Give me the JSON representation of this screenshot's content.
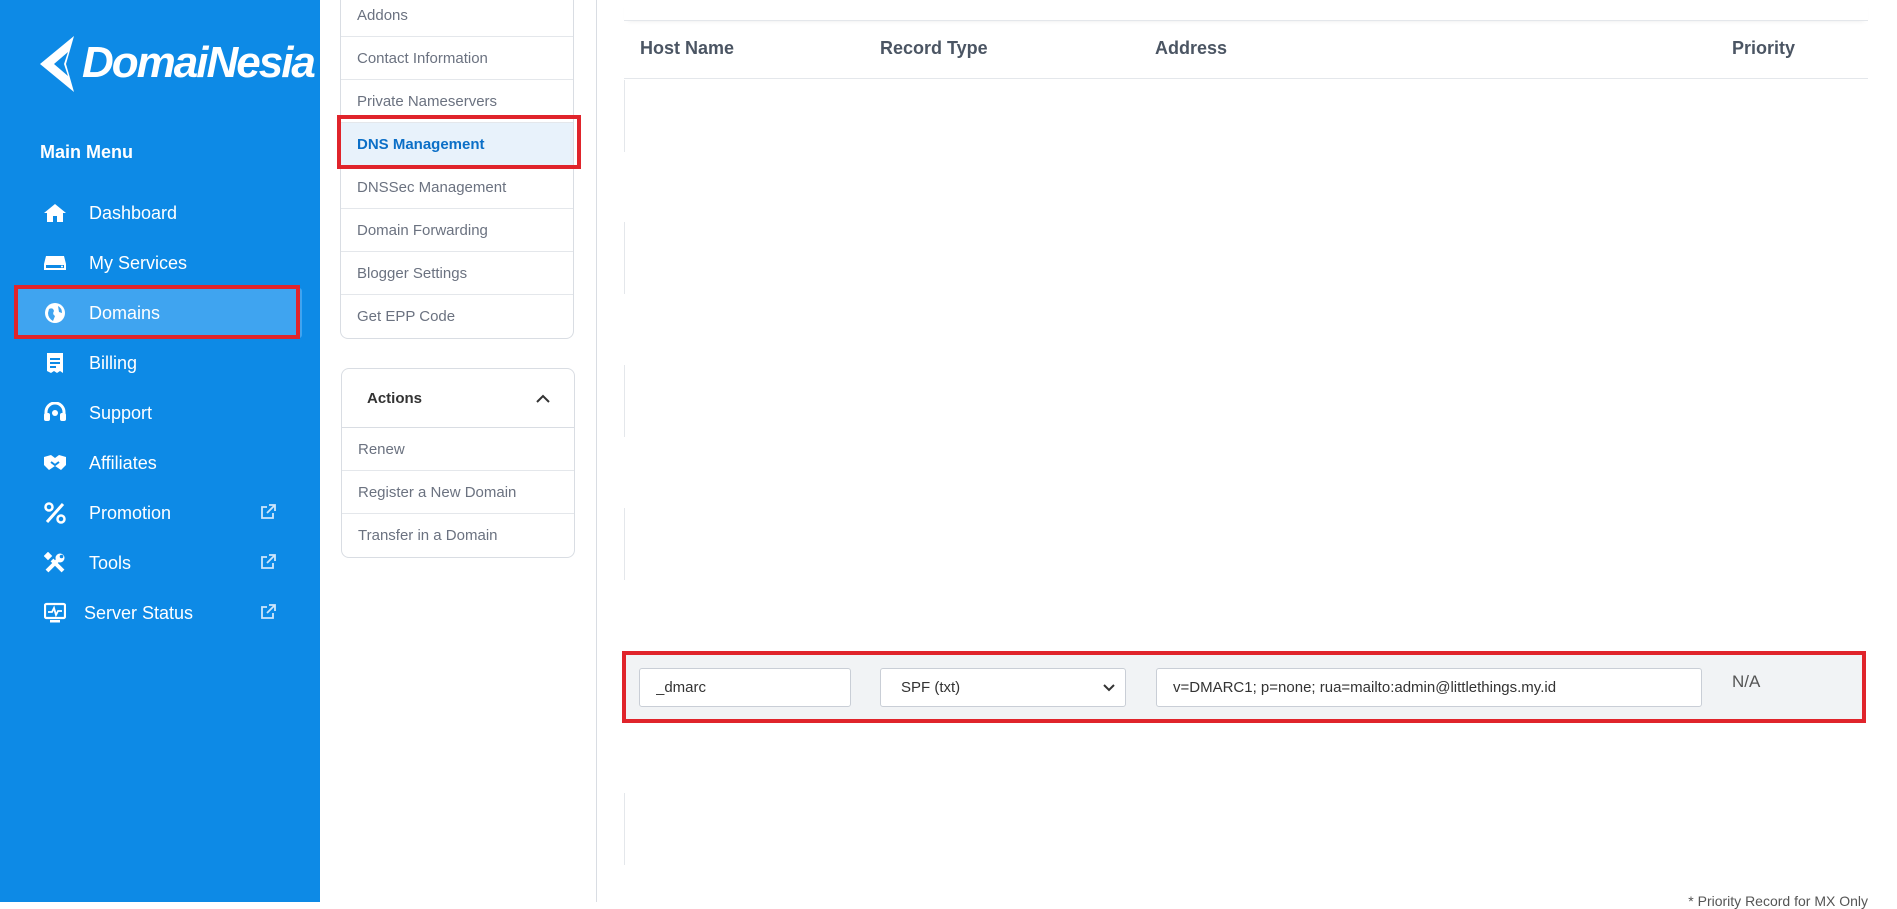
{
  "brand": {
    "name": "DomaiNesia"
  },
  "sidebar": {
    "title": "Main Menu",
    "items": [
      {
        "label": "Dashboard",
        "icon": "home-icon"
      },
      {
        "label": "My Services",
        "icon": "server-icon"
      },
      {
        "label": "Domains",
        "icon": "globe-icon",
        "active": true
      },
      {
        "label": "Billing",
        "icon": "receipt-icon"
      },
      {
        "label": "Support",
        "icon": "headset-icon"
      },
      {
        "label": "Affiliates",
        "icon": "handshake-icon"
      },
      {
        "label": "Promotion",
        "icon": "percent-icon",
        "external": true
      },
      {
        "label": "Tools",
        "icon": "tools-icon",
        "external": true
      },
      {
        "label": "Server Status",
        "icon": "monitor-icon",
        "external": true
      }
    ]
  },
  "subnav": {
    "items": [
      {
        "label": "Addons"
      },
      {
        "label": "Contact Information"
      },
      {
        "label": "Private Nameservers"
      },
      {
        "label": "DNS Management",
        "active": true
      },
      {
        "label": "DNSSec Management"
      },
      {
        "label": "Domain Forwarding"
      },
      {
        "label": "Blogger Settings"
      },
      {
        "label": "Get EPP Code"
      }
    ]
  },
  "actions": {
    "title": "Actions",
    "items": [
      {
        "label": "Renew"
      },
      {
        "label": "Register a New Domain"
      },
      {
        "label": "Transfer in a Domain"
      }
    ]
  },
  "dns_table": {
    "headers": {
      "host": "Host Name",
      "type": "Record Type",
      "address": "Address",
      "priority": "Priority"
    },
    "record": {
      "host": "_dmarc",
      "type": "SPF (txt)",
      "address": "v=DMARC1; p=none; rua=mailto:admin@littlethings.my.id",
      "priority": "N/A"
    },
    "footnote": "* Priority Record for MX Only"
  },
  "colors": {
    "sidebar_bg": "#0d8ae6",
    "highlight": "#e0242b",
    "active_link": "#0b6fc7"
  }
}
